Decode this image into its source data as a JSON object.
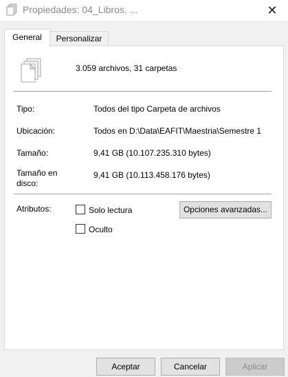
{
  "window": {
    "title": "Propiedades: 04_Libros, ...",
    "close_glyph": "✕"
  },
  "tabs": [
    {
      "label": "General",
      "active": true
    },
    {
      "label": "Personalizar",
      "active": false
    }
  ],
  "general": {
    "icon": "folder-files-icon",
    "summary": "3.059 archivos, 31 carpetas",
    "rows": [
      {
        "label": "Tipo:",
        "value": "Todos del tipo Carpeta de archivos"
      },
      {
        "label": "Ubicación:",
        "value": "Todos en D:\\Data\\EAFIT\\Maestria\\Semestre 1"
      },
      {
        "label": "Tamaño:",
        "value": "9,41 GB (10.107.235.310 bytes)"
      },
      {
        "label": "Tamaño en disco:",
        "value": "9,41 GB (10.113.458.176 bytes)"
      }
    ],
    "attributes": {
      "label": "Atributos:",
      "readonly_label": "Solo lectura",
      "readonly_checked": false,
      "hidden_label": "Oculto",
      "hidden_checked": false,
      "advanced_button": "Opciones avanzadas..."
    }
  },
  "footer": {
    "accept": "Aceptar",
    "cancel": "Cancelar",
    "apply": "Aplicar",
    "apply_enabled": false
  }
}
